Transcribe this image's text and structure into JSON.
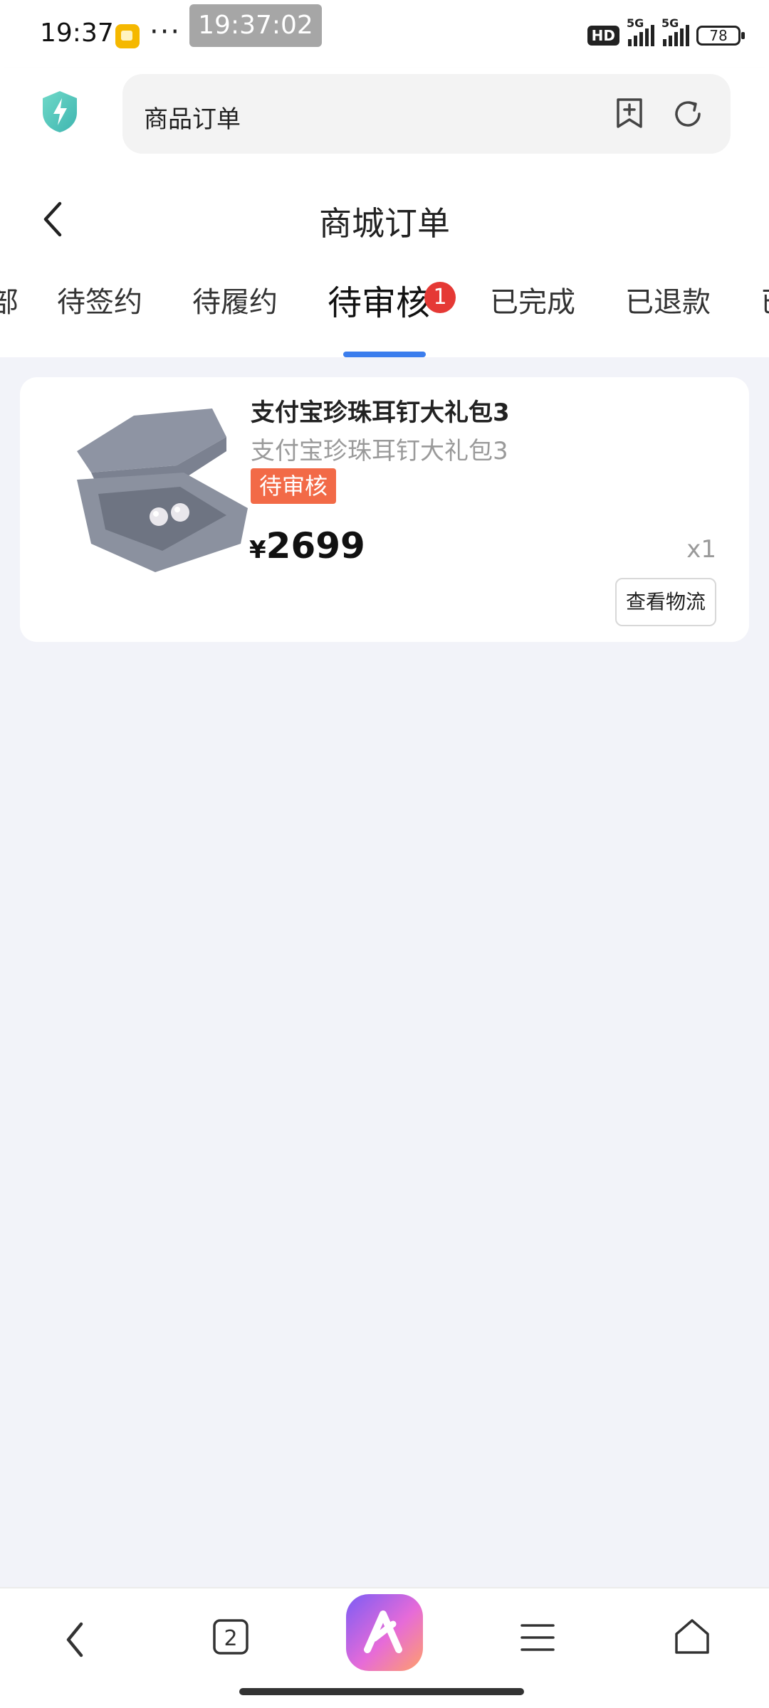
{
  "status_bar": {
    "time": "19:37",
    "clock_pill": "19:37:02",
    "more": "···",
    "hd": "HD",
    "signal1_label": "5G",
    "signal2_label": "5G",
    "battery": "78"
  },
  "browser": {
    "address_text": "商品订单",
    "icons": [
      "shield-icon",
      "bookmark-add-icon",
      "refresh-icon"
    ]
  },
  "header": {
    "title": "商城订单",
    "tabs": [
      {
        "label": "部"
      },
      {
        "label": "待签约"
      },
      {
        "label": "待履约"
      },
      {
        "label": "待审核",
        "active": true,
        "badge": "1"
      },
      {
        "label": "已完成"
      },
      {
        "label": "已退款"
      },
      {
        "label": "已"
      }
    ]
  },
  "order": {
    "title": "支付宝珍珠耳钉大礼包3",
    "subtitle": "支付宝珍珠耳钉大礼包3",
    "status": "待审核",
    "currency": "¥",
    "price": "2699",
    "quantity": "x1",
    "logistics_button": "查看物流"
  },
  "bottom_nav": {
    "tab_count": "2",
    "icons": [
      "back-icon",
      "tabs-icon",
      "ai-assistant-icon",
      "menu-icon",
      "home-icon"
    ]
  },
  "colors": {
    "accent_blue": "#3b7ded",
    "status_orange": "#f26a47",
    "badge_red": "#e53935",
    "page_bg": "#f2f3f9"
  }
}
